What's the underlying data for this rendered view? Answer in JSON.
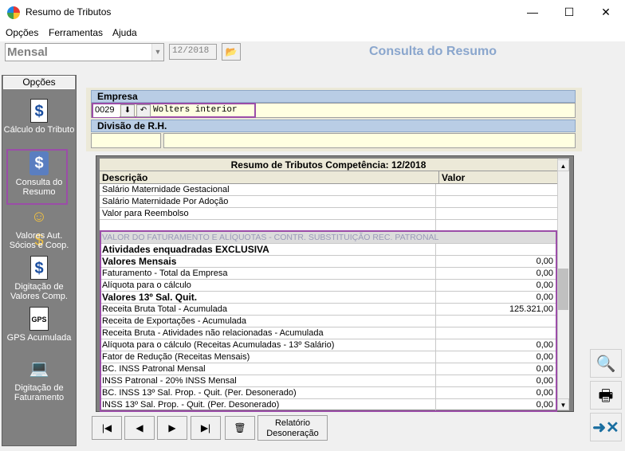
{
  "window": {
    "title": "Resumo de Tributos",
    "minimize": "—",
    "maximize": "☐",
    "close": "✕"
  },
  "menu": [
    "Opções",
    "Ferramentas",
    "Ajuda"
  ],
  "toolbar": {
    "mode": "Mensal",
    "period": "12/2018",
    "page_title": "Consulta do Resumo"
  },
  "left": {
    "tab": "Opções",
    "items": [
      {
        "label": "Cálculo do Tributo",
        "icon": "document-dollar-icon"
      },
      {
        "label": "Consulta do Resumo",
        "icon": "computer-dollar-icon"
      },
      {
        "label": "Valores Aut. Sócios e Coop.",
        "icon": "people-dollar-icon"
      },
      {
        "label": "Digitação de Valores Comp.",
        "icon": "document-input-icon"
      },
      {
        "label": "GPS Acumulada",
        "icon": "gps-document-icon"
      },
      {
        "label": "Digitação de Faturamento",
        "icon": "laptop-icon"
      }
    ]
  },
  "empresa": {
    "header": "Empresa",
    "code": "0029",
    "name": "Wolters interior"
  },
  "divisao": {
    "header": "Divisão de R.H.",
    "code": "",
    "name": ""
  },
  "grid": {
    "title": "Resumo de Tributos Competência: 12/2018",
    "col_desc": "Descrição",
    "col_val": "Valor",
    "rows": [
      {
        "d": "Salário Maternidade Gestacional",
        "v": "",
        "t": "n"
      },
      {
        "d": "Salário Maternidade Por Adoção",
        "v": "",
        "t": "n"
      },
      {
        "d": "Valor para Reembolso",
        "v": "",
        "t": "n"
      },
      {
        "d": "",
        "v": "",
        "t": "n"
      },
      {
        "d": "VALOR DO FATURAMENTO E ALÍQUOTAS - CONTR. SUBSTITUIÇÃO REC. PATRONAL",
        "v": "",
        "t": "s"
      },
      {
        "d": "Atividades enquadradas EXCLUSIVA",
        "v": "",
        "t": "b"
      },
      {
        "d": "Valores Mensais",
        "v": "0,00",
        "t": "b"
      },
      {
        "d": "Faturamento - Total da Empresa",
        "v": "0,00",
        "t": "n"
      },
      {
        "d": "Alíquota para o cálculo",
        "v": "0,00",
        "t": "n"
      },
      {
        "d": "Valores 13º Sal. Quit.",
        "v": "0,00",
        "t": "b"
      },
      {
        "d": "Receita Bruta Total - Acumulada",
        "v": "125.321,00",
        "t": "n"
      },
      {
        "d": "Receita de Exportações - Acumulada",
        "v": "",
        "t": "n"
      },
      {
        "d": "Receita Bruta - Atividades não relacionadas - Acumulada",
        "v": "",
        "t": "n"
      },
      {
        "d": "Alíquota para o cálculo (Receitas Acumuladas - 13º Salário)",
        "v": "0,00",
        "t": "n"
      },
      {
        "d": "Fator de Redução (Receitas Mensais)",
        "v": "0,00",
        "t": "n"
      },
      {
        "d": "BC. INSS Patronal Mensal",
        "v": "0,00",
        "t": "n"
      },
      {
        "d": "INSS Patronal - 20% INSS Mensal",
        "v": "0,00",
        "t": "n"
      },
      {
        "d": "BC. INSS 13º Sal. Prop. - Quit. (Per. Desonerado)",
        "v": "0,00",
        "t": "n"
      },
      {
        "d": "INSS 13º Sal. Prop. - Quit. (Per. Desonerado)",
        "v": "0,00",
        "t": "n"
      }
    ]
  },
  "bottom": {
    "first": "|◀",
    "prev": "◀",
    "next": "▶",
    "last": "▶|",
    "relatorio": "Relatório Desoneração"
  },
  "icons": {
    "open": "folder-open-icon",
    "download": "download-arrow-icon",
    "undo": "undo-icon",
    "trash": "trash-icon",
    "search_person": "search-person-icon",
    "printer": "printer-icon",
    "exit": "exit-icon"
  }
}
